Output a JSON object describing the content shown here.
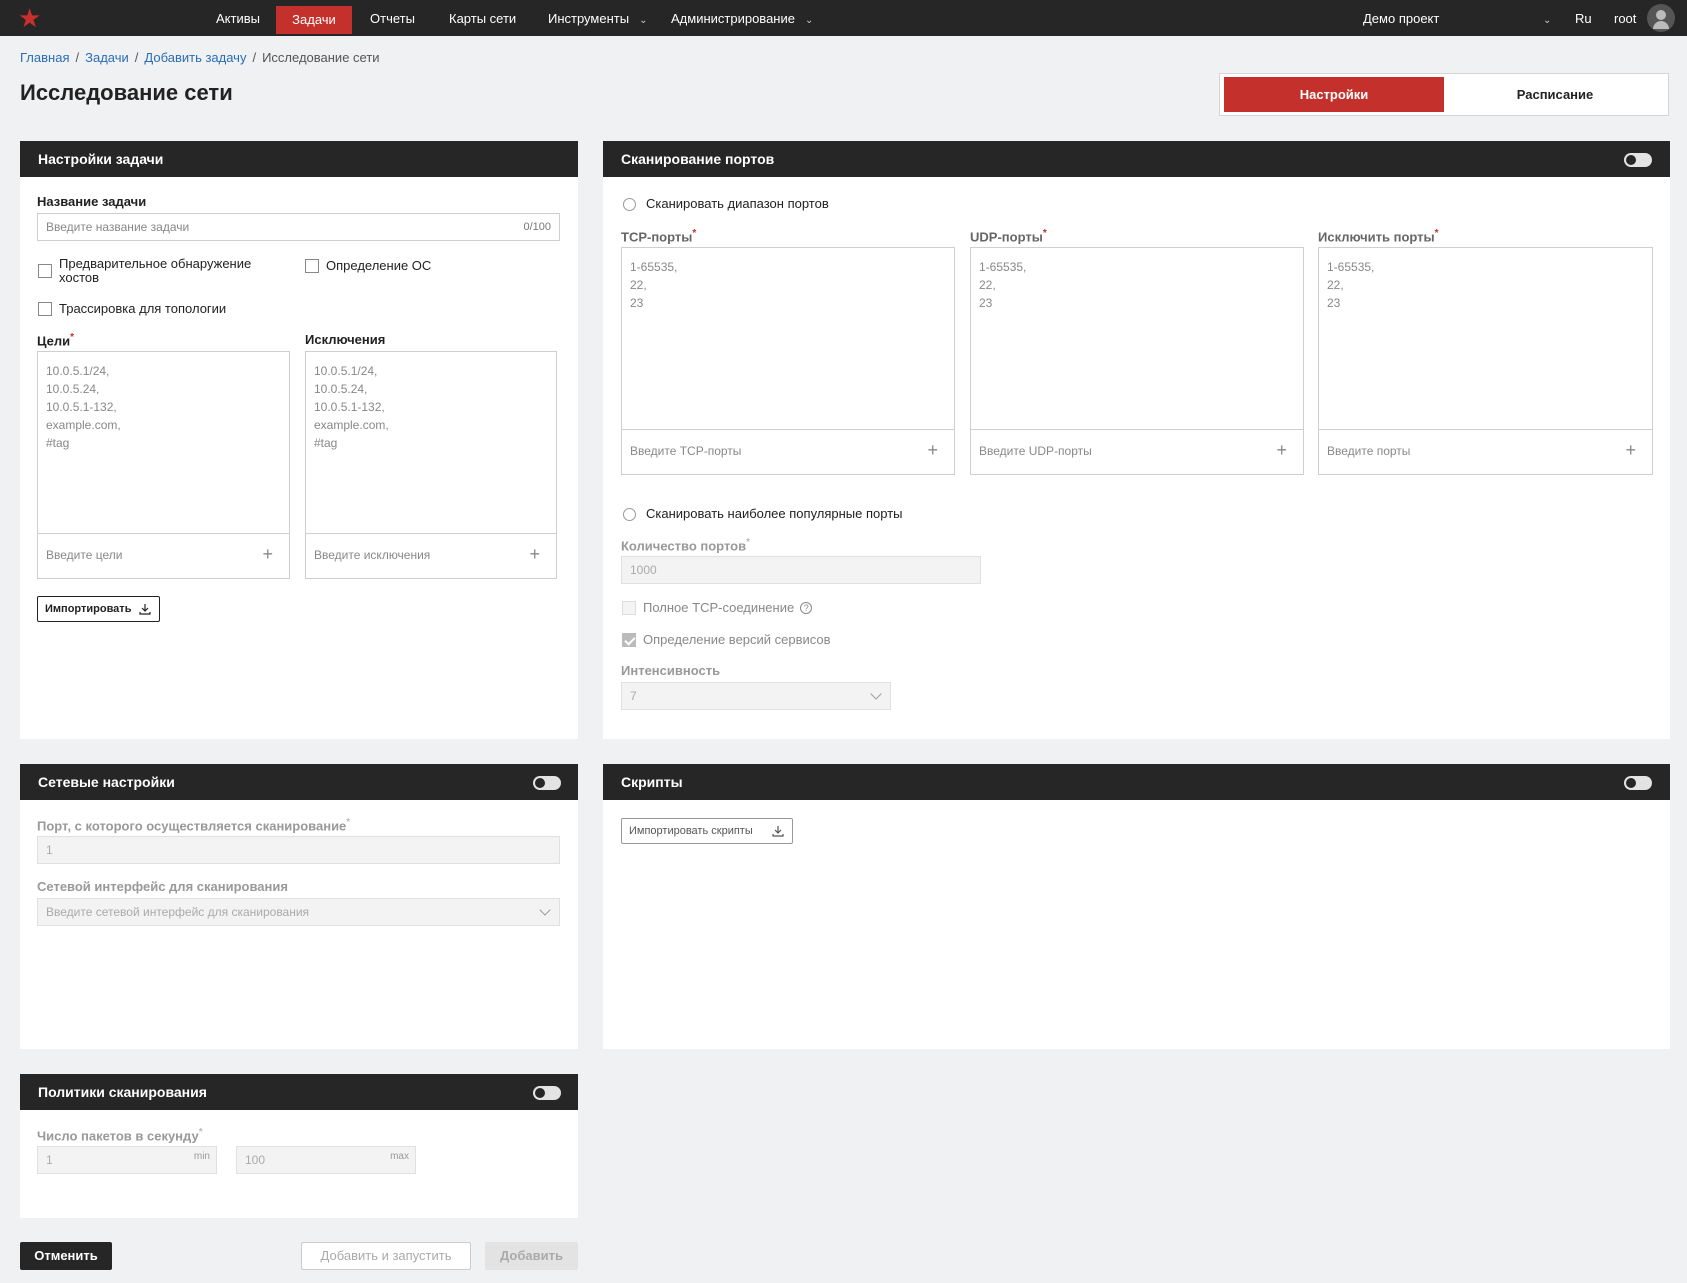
{
  "nav": {
    "items": [
      {
        "label": "Активы"
      },
      {
        "label": "Задачи"
      },
      {
        "label": "Отчеты"
      },
      {
        "label": "Карты сети"
      },
      {
        "label": "Инструменты"
      },
      {
        "label": "Администрирование"
      }
    ],
    "project": "Демо проект",
    "language": "Ru",
    "user": "root"
  },
  "breadcrumb": [
    "Главная",
    "Задачи",
    "Добавить задачу",
    "Исследование сети"
  ],
  "page_title": "Исследование сети",
  "tabs": [
    "Настройки",
    "Расписание"
  ],
  "task_settings": {
    "title": "Настройки задачи",
    "name_label": "Название задачи",
    "name_placeholder": "Введите название задачи",
    "name_counter": "0/100",
    "cb_prediscovery": "Предварительное обнаружение хостов",
    "cb_os": "Определение ОС",
    "cb_traceroute": "Трассировка для топологии",
    "targets_label": "Цели",
    "targets_example": "10.0.5.1/24,\n10.0.5.24,\n10.0.5.1-132,\nexample.com,\n#tag",
    "targets_placeholder": "Введите цели",
    "exclusions_label": "Исключения",
    "exclusions_example": "10.0.5.1/24,\n10.0.5.24,\n10.0.5.1-132,\nexample.com,\n#tag",
    "exclusions_placeholder": "Введите исключения",
    "import_label": "Импортировать"
  },
  "port_scan": {
    "title": "Сканирование портов",
    "radio_range": "Сканировать диапазон портов",
    "tcp_label": "TCP-порты",
    "tcp_example": "1-65535,\n22,\n23",
    "tcp_placeholder": "Введите TCP-порты",
    "udp_label": "UDP-порты",
    "udp_example": "1-65535,\n22,\n23",
    "udp_placeholder": "Введите UDP-порты",
    "exclude_label": "Исключить порты",
    "exclude_example": "1-65535,\n22,\n23",
    "exclude_placeholder": "Введите порты",
    "radio_popular": "Сканировать наиболее популярные порты",
    "count_label": "Количество портов",
    "count_value": "1000",
    "cb_full_tcp": "Полное TCP-соединение",
    "cb_versions": "Определение версий сервисов",
    "intensity_label": "Интенсивность",
    "intensity_value": "7"
  },
  "network": {
    "title": "Сетевые настройки",
    "port_label": "Порт, с которого осуществляется сканирование",
    "port_value": "1",
    "iface_label": "Сетевой интерфейс для сканирования",
    "iface_placeholder": "Введите сетевой интерфейс для сканирования"
  },
  "scripts": {
    "title": "Скрипты",
    "import_label": "Импортировать скрипты"
  },
  "policies": {
    "title": "Политики сканирования",
    "pps_label": "Число пакетов в секунду",
    "min_value": "1",
    "min_suffix": "min",
    "max_value": "100",
    "max_suffix": "max"
  },
  "footer": {
    "cancel": "Отменить",
    "add_and_run": "Добавить и запустить",
    "add": "Добавить"
  },
  "colors": {
    "accent": "#c4302b",
    "header": "#262626"
  }
}
